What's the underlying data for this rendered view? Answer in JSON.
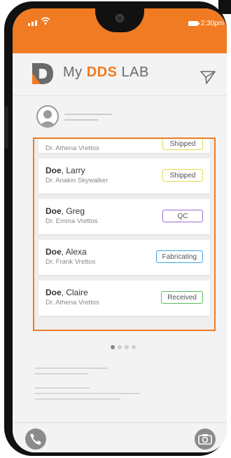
{
  "status_bar": {
    "time": "2:30pm"
  },
  "app": {
    "title_prefix": "My",
    "title_brand": "DDS",
    "title_suffix": "LAB",
    "accent_color": "#f07b22"
  },
  "orders": [
    {
      "last": "",
      "first": "",
      "doctor": "Dr. Athena Vrettos",
      "status": "Shipped"
    },
    {
      "last": "Doe",
      "first": ", Larry",
      "doctor": "Dr. Anakin Skywalker",
      "status": "Shipped"
    },
    {
      "last": "Doe",
      "first": ", Greg",
      "doctor": "Dr. Emma Vrettos",
      "status": "QC"
    },
    {
      "last": "Doe",
      "first": ", Alexa",
      "doctor": "Dr. Frank Vrettos",
      "status": "Fabricating"
    },
    {
      "last": "Doe",
      "first": ", Claire",
      "doctor": "Dr. Athena Vrettos",
      "status": "Received"
    }
  ],
  "status_colors": {
    "Shipped": "#e7d84b",
    "QC": "#a26bd1",
    "Fabricating": "#3fa3df",
    "Received": "#5cb85c"
  },
  "icons": {
    "send": "send-icon",
    "phone": "phone-icon",
    "camera": "camera-icon",
    "avatar": "user-avatar-icon"
  }
}
